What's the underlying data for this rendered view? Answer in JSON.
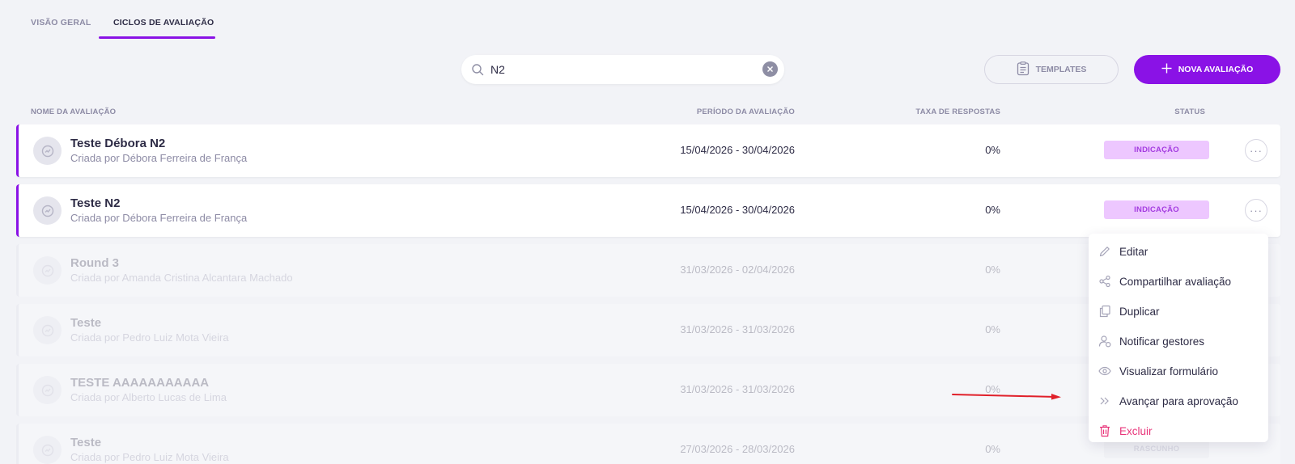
{
  "tabs": [
    {
      "label": "VISÃO GERAL",
      "active": false
    },
    {
      "label": "CICLOS DE AVALIAÇÃO",
      "active": true
    }
  ],
  "search": {
    "value": "N2",
    "placeholder": ""
  },
  "actions": {
    "templates_label": "TEMPLATES",
    "new_label": "NOVA AVALIAÇÃO"
  },
  "table": {
    "columns": [
      "NOME DA AVALIAÇÃO",
      "PERÍODO DA AVALIAÇÃO",
      "TAXA DE RESPOSTAS",
      "STATUS"
    ],
    "rows": [
      {
        "name": "Teste Débora N2",
        "creator": "Criada por Débora Ferreira de França",
        "period": "15/04/2026 - 30/04/2026",
        "rate": "0%",
        "status": "INDICAÇÃO"
      },
      {
        "name": "Teste N2",
        "creator": "Criada por Débora Ferreira de França",
        "period": "15/04/2026 - 30/04/2026",
        "rate": "0%",
        "status": "INDICAÇÃO"
      },
      {
        "name": "Round 3",
        "creator": "Criada por Amanda Cristina Alcantara Machado",
        "period": "31/03/2026 - 02/04/2026",
        "rate": "0%",
        "status": ""
      },
      {
        "name": "Teste",
        "creator": "Criada por Pedro Luiz Mota Vieira",
        "period": "31/03/2026 - 31/03/2026",
        "rate": "0%",
        "status": ""
      },
      {
        "name": "TESTE AAAAAAAAAAA",
        "creator": "Criada por Alberto Lucas de Lima",
        "period": "31/03/2026 - 31/03/2026",
        "rate": "0%",
        "status": ""
      },
      {
        "name": "Teste",
        "creator": "Criada por Pedro Luiz Mota Vieira",
        "period": "27/03/2026 - 28/03/2026",
        "rate": "0%",
        "status": "RASCUNHO"
      }
    ]
  },
  "menu": {
    "items": [
      {
        "label": "Editar",
        "icon": "pencil-icon"
      },
      {
        "label": "Compartilhar avaliação",
        "icon": "share-icon"
      },
      {
        "label": "Duplicar",
        "icon": "copy-icon"
      },
      {
        "label": "Notificar gestores",
        "icon": "notify-user-icon"
      },
      {
        "label": "Visualizar formulário",
        "icon": "eye-icon"
      },
      {
        "label": "Avançar para aprovação",
        "icon": "double-chevron-right-icon"
      },
      {
        "label": "Excluir",
        "icon": "trash-icon"
      }
    ]
  },
  "colors": {
    "accent": "#8a12e6",
    "badge_bg": "#edc7ff",
    "badge_text": "#a43ce0",
    "danger": "#e8357a",
    "annotation": "#e0202a"
  }
}
